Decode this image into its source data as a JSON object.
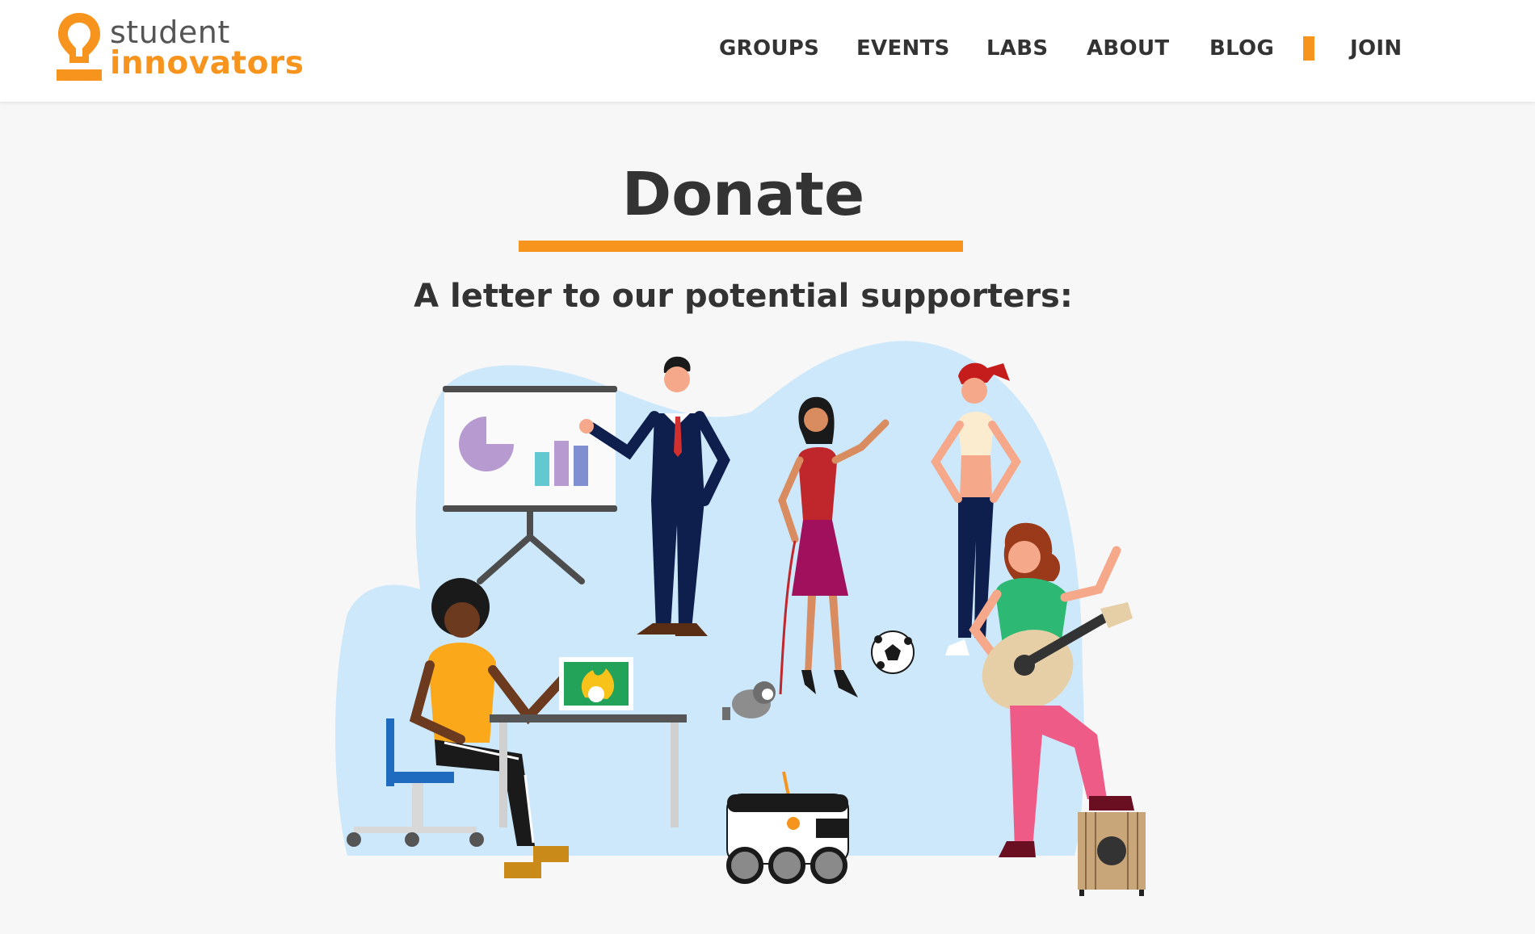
{
  "brand": {
    "line1": "student",
    "line2": "innovators",
    "accent_color": "#f7941d"
  },
  "nav": {
    "items": [
      {
        "label": "GROUPS"
      },
      {
        "label": "EVENTS"
      },
      {
        "label": "LABS"
      },
      {
        "label": "ABOUT"
      },
      {
        "label": "BLOG"
      },
      {
        "label": "JOIN"
      }
    ]
  },
  "page": {
    "title": "Donate",
    "subtitle": "A letter to our potential supporters:"
  },
  "illustration": {
    "icon": "people-community-illustration",
    "elements": [
      "presentation-board",
      "businessman",
      "woman-with-dog",
      "athletic-woman",
      "soccer-ball",
      "student-at-laptop",
      "delivery-robot",
      "guitarist",
      "speaker-box"
    ]
  }
}
